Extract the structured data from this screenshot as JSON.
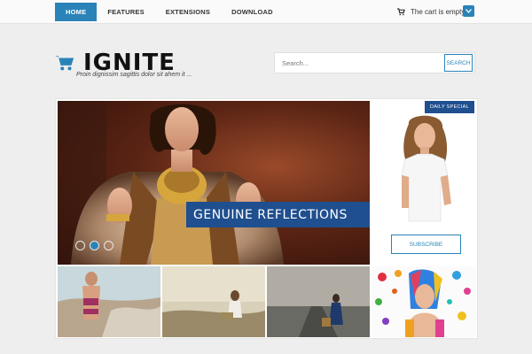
{
  "nav": {
    "items": [
      "HOME",
      "FEATURES",
      "EXTENSIONS",
      "DOWNLOAD"
    ],
    "active_index": 0
  },
  "cart": {
    "label": "The cart is empty",
    "icon": "cart-icon",
    "toggle_icon": "chevron-down-icon"
  },
  "header": {
    "logo": "IGNITE",
    "tagline": "Proin dignissim sagittis dolor sit ahem it ...",
    "logo_icon": "cart-icon"
  },
  "search": {
    "placeholder": "Search...",
    "button": "SEARCH"
  },
  "slider": {
    "caption": "GENUINE REFLECTIONS",
    "dots": 3,
    "active_dot": 1
  },
  "special": {
    "badge": "DAILY SPECIAL",
    "button": "SUBSCRIBE"
  },
  "colors": {
    "accent": "#2a83b8",
    "dark_blue": "#1f4f8f",
    "background": "#eeeeee"
  }
}
